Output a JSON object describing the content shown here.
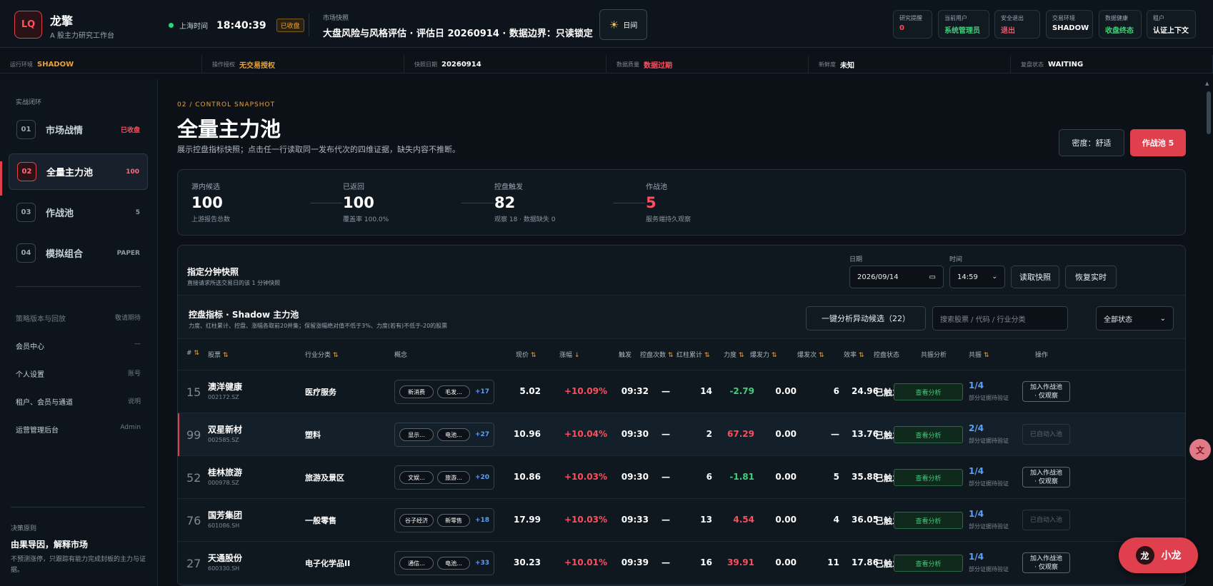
{
  "brand": {
    "logo": "LQ",
    "name": "龙擎",
    "subtitle": "A 股主力研究工作台"
  },
  "clock": {
    "label": "上海时间",
    "time": "18:40:39",
    "status": "已收盘"
  },
  "market": {
    "label": "市场快照",
    "text": "大盘风险与风格评估 · 评估日 20260914 · 数据边界：只读锁定"
  },
  "theme": {
    "icon": "sun-icon",
    "label": "日间"
  },
  "status_chips": [
    {
      "key": "研究提醒",
      "value": "0",
      "color": "#ff4d5e"
    },
    {
      "key": "当前用户",
      "value": "系统管理员",
      "color": "#3fd07a"
    },
    {
      "key": "安全退出",
      "value": "退出",
      "color": "#ff4d5e"
    },
    {
      "key": "交易环境",
      "value": "SHADOW",
      "color": "#ffffff"
    },
    {
      "key": "数据健康",
      "value": "收盘终态",
      "color": "#3fd07a"
    },
    {
      "key": "租户",
      "value": "认证上下文",
      "color": "#ffffff"
    }
  ],
  "env": [
    {
      "key": "运行环境",
      "value": "SHADOW",
      "color": "#e9a23b"
    },
    {
      "key": "操作授权",
      "value": "无交易授权",
      "color": "#e9a23b"
    },
    {
      "key": "快照日期",
      "value": "20260914",
      "color": "#ffffff"
    },
    {
      "key": "数据质量",
      "value": "数据过期",
      "color": "#ff4d5e"
    },
    {
      "key": "新鲜度",
      "value": "未知",
      "color": "#ffffff"
    },
    {
      "key": "复盘状态",
      "value": "WAITING",
      "color": "#ffffff"
    }
  ],
  "sidebar": {
    "section": "实战闭环",
    "items": [
      {
        "num": "01",
        "label": "市场战情",
        "count": "已收盘",
        "count_color": "#ff4d5e"
      },
      {
        "num": "02",
        "label": "全量主力池",
        "count": "100",
        "count_color": "#ff6b77"
      },
      {
        "num": "03",
        "label": "作战池",
        "count": "5",
        "count_color": "#8a96a2"
      },
      {
        "num": "04",
        "label": "模拟组合",
        "count": "PAPER",
        "count_color": "#8a96a2"
      }
    ],
    "links": [
      {
        "label": "策略版本与回放",
        "right": "敬请期待",
        "dim": true
      },
      {
        "label": "会员中心",
        "right": "—",
        "dim": false
      },
      {
        "label": "个人设置",
        "right": "账号",
        "dim": false
      },
      {
        "label": "租户、会员与通道",
        "right": "说明",
        "dim": false
      },
      {
        "label": "运营管理后台",
        "right": "Admin",
        "dim": false
      }
    ],
    "footer": {
      "key": "决策原则",
      "title": "由果导因，解释市场",
      "desc": "不预测涨停，只跟踪有能力完成封板的主力与证据。"
    }
  },
  "page": {
    "crumb": "02 / CONTROL SNAPSHOT",
    "title": "全量主力池",
    "desc": "展示控盘指标快照；点击任一行读取同一发布代次的四维证据，缺失内容不推断。",
    "density": "密度：舒适",
    "pool_button": "作战池 5"
  },
  "stats": [
    {
      "key": "源内候选",
      "value": "100",
      "sub": "上游报告总数",
      "color": "#ffffff"
    },
    {
      "key": "已返回",
      "value": "100",
      "sub": "覆盖率 100.0%",
      "color": "#ffffff"
    },
    {
      "key": "控盘触发",
      "value": "82",
      "sub": "观察 18 · 数据缺失 0",
      "color": "#ffffff"
    },
    {
      "key": "作战池",
      "value": "5",
      "sub": "服务端持久观察",
      "color": "#ff4d5e"
    }
  ],
  "snapshot": {
    "title": "指定分钟快照",
    "sub": "直接请求所选交易日的该 1 分钟快照",
    "date_label": "日期",
    "date_value": "2026/09/14",
    "time_label": "时间",
    "time_value": "14:59",
    "read_btn": "读取快照",
    "restore_btn": "恢复实时"
  },
  "section": {
    "title": "控盘指标 · Shadow 主力池",
    "sub": "力度、红柱累计、控盘、涨幅各取前20并集；保留涨幅绝对值不低于3%、力度(若有)不低于-20的股票",
    "analyze_btn": "一键分析异动候选（22）",
    "search_placeholder": "搜索股票 / 代码 / 行业分类",
    "filter": "全部状态"
  },
  "columns": {
    "idx": "#",
    "stock": "股票",
    "industry": "行业分类",
    "concept": "概念",
    "price": "现价",
    "change": "涨幅",
    "trigger": "触发",
    "ctrl": "控盘次数",
    "red": "红柱累计",
    "force": "力度",
    "burst": "爆发力",
    "burst_n": "爆发次",
    "eff": "效率",
    "state": "控盘状态",
    "share": "共振分析",
    "cons": "共振",
    "op": "操作"
  },
  "rows": [
    {
      "idx": "15",
      "name": "澳洋健康",
      "code": "002172.SZ",
      "industry": "医疗服务",
      "tags": [
        "新消费",
        "毛发..."
      ],
      "more": "+17",
      "price": "5.02",
      "change": "+10.09%",
      "trigger": "09:32",
      "ctrl": "—",
      "red": "14",
      "force": "-2.79",
      "force_color": "#3fd07a",
      "burst": "0.00",
      "burst_n": "6",
      "eff": "24.96",
      "state": "已触发",
      "share": "查看分析",
      "cons": "1/4",
      "cons_sub": "部分证据待验证",
      "act1": "加入作战池",
      "act2": "· 仅观察",
      "disabled": false,
      "hl": false
    },
    {
      "idx": "99",
      "name": "双星新材",
      "code": "002585.SZ",
      "industry": "塑料",
      "tags": [
        "显示...",
        "电池..."
      ],
      "more": "+27",
      "price": "10.96",
      "change": "+10.04%",
      "trigger": "09:30",
      "ctrl": "—",
      "red": "2",
      "force": "67.29",
      "force_color": "#ff4d5e",
      "burst": "0.00",
      "burst_n": "—",
      "eff": "13.76",
      "state": "已触发",
      "share": "查看分析",
      "cons": "2/4",
      "cons_sub": "部分证据待验证",
      "act1": "已自动入池",
      "act2": "",
      "disabled": true,
      "hl": true
    },
    {
      "idx": "52",
      "name": "桂林旅游",
      "code": "000978.SZ",
      "industry": "旅游及景区",
      "tags": [
        "文娱...",
        "旅游..."
      ],
      "more": "+20",
      "price": "10.86",
      "change": "+10.03%",
      "trigger": "09:30",
      "ctrl": "—",
      "red": "6",
      "force": "-1.81",
      "force_color": "#3fd07a",
      "burst": "0.00",
      "burst_n": "5",
      "eff": "35.88",
      "state": "已触发",
      "share": "查看分析",
      "cons": "1/4",
      "cons_sub": "部分证据待验证",
      "act1": "加入作战池",
      "act2": "· 仅观察",
      "disabled": false,
      "hl": false
    },
    {
      "idx": "76",
      "name": "国芳集团",
      "code": "601086.SH",
      "industry": "一般零售",
      "tags": [
        "谷子经济",
        "新零售"
      ],
      "more": "+18",
      "price": "17.99",
      "change": "+10.03%",
      "trigger": "09:33",
      "ctrl": "—",
      "red": "13",
      "force": "4.54",
      "force_color": "#ff4d5e",
      "burst": "0.00",
      "burst_n": "4",
      "eff": "36.05",
      "state": "已触发",
      "share": "查看分析",
      "cons": "1/4",
      "cons_sub": "部分证据待验证",
      "act1": "已自动入池",
      "act2": "",
      "disabled": true,
      "hl": false
    },
    {
      "idx": "27",
      "name": "天通股份",
      "code": "600330.SH",
      "industry": "电子化学品II",
      "tags": [
        "通信...",
        "电池..."
      ],
      "more": "+33",
      "price": "30.23",
      "change": "+10.01%",
      "trigger": "09:39",
      "ctrl": "—",
      "red": "16",
      "force": "39.91",
      "force_color": "#ff4d5e",
      "burst": "0.00",
      "burst_n": "11",
      "eff": "17.86",
      "state": "已触发",
      "share": "查看分析",
      "cons": "1/4",
      "cons_sub": "部分证据待验证",
      "act1": "加入作战池",
      "act2": "· 仅观察",
      "disabled": false,
      "hl": false
    }
  ],
  "floating": {
    "translate_icon": "translate-icon",
    "assistant_icon": "龙",
    "assistant_label": "小龙"
  }
}
